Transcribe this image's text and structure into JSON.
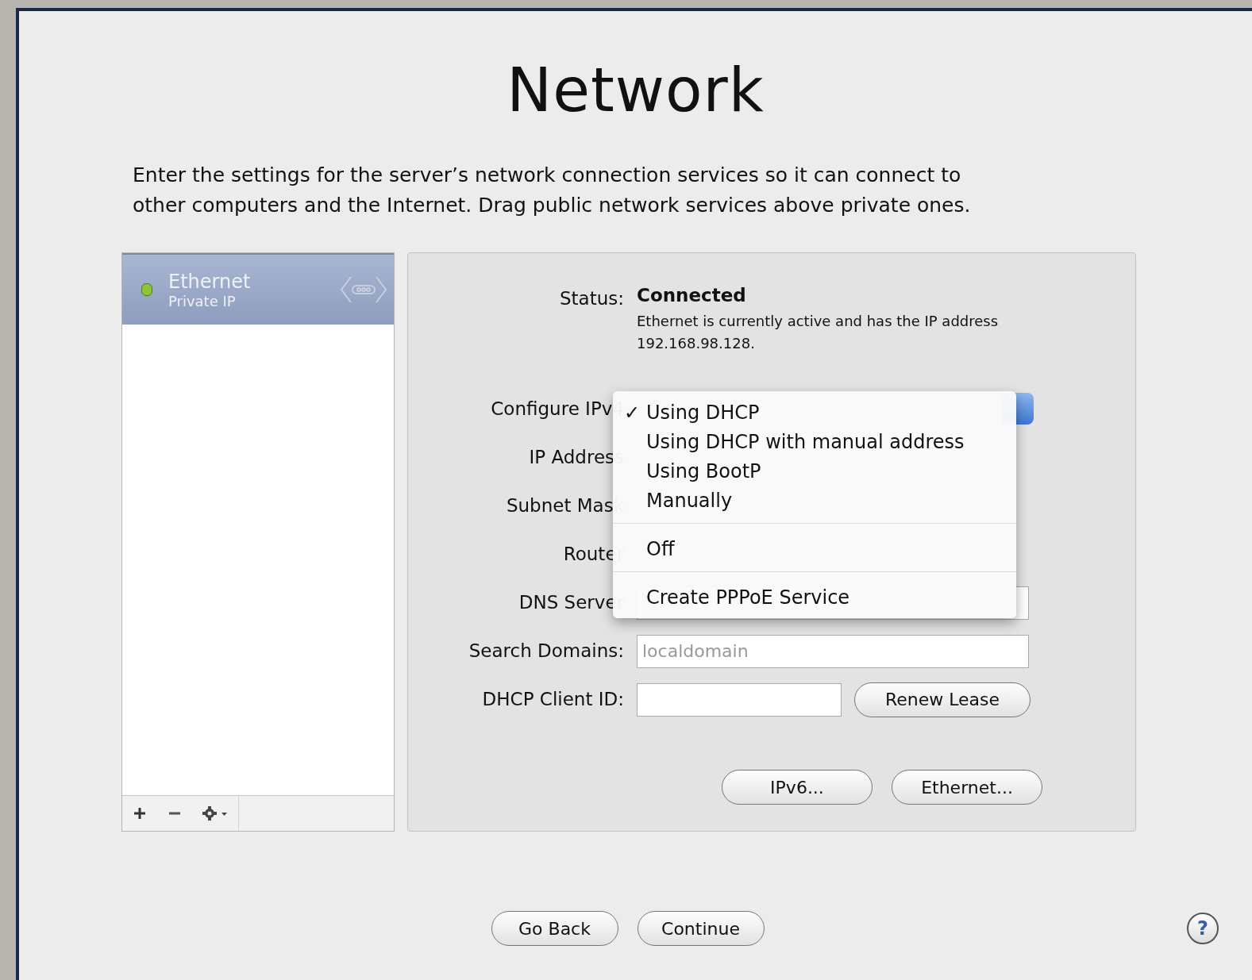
{
  "title": "Network",
  "description_lines": [
    "Enter the settings for the server’s network connection services so it can connect to",
    "other computers and the Internet. Drag public network services above private ones."
  ],
  "services": [
    {
      "name": "Ethernet",
      "detail": "Private IP",
      "selected": true,
      "color": "#8cc43c"
    }
  ],
  "status": {
    "label": "Status:",
    "value": "Connected",
    "message": "Ethernet is currently active and has the IP address 192.168.98.128."
  },
  "fields": [
    {
      "label": "Configure IPv4",
      "kind": "popup"
    },
    {
      "label": "IP Address",
      "kind": "static"
    },
    {
      "label": "Subnet Mask",
      "kind": "static"
    },
    {
      "label": "Router",
      "kind": "static"
    },
    {
      "label": "DNS Server",
      "kind": "input"
    },
    {
      "label": "Search Domains:",
      "kind": "input",
      "placeholder": "localdomain"
    },
    {
      "label": "DHCP Client ID:",
      "kind": "input_button",
      "button": "Renew Lease"
    }
  ],
  "popup_menu": [
    {
      "kind": "item",
      "label": "Using DHCP",
      "selected": true
    },
    {
      "kind": "item",
      "label": "Using DHCP with manual address",
      "selected": false
    },
    {
      "kind": "item",
      "label": "Using BootP",
      "selected": false
    },
    {
      "kind": "item",
      "label": "Manually",
      "selected": false
    },
    {
      "kind": "separator"
    },
    {
      "kind": "item",
      "label": "Off",
      "selected": false
    },
    {
      "kind": "separator"
    },
    {
      "kind": "item",
      "label": "Create PPPoE Service",
      "selected": false
    }
  ],
  "check_mark": "✓",
  "panel_buttons": [
    "IPv6...",
    "Ethernet..."
  ],
  "footer_buttons": [
    "Go Back",
    "Continue"
  ],
  "help": "?"
}
